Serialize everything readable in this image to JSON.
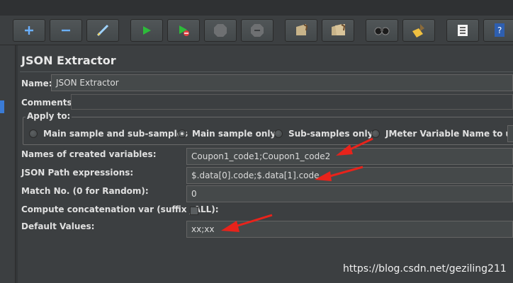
{
  "title": "JSON Extractor",
  "name": {
    "label": "Name:",
    "value": "JSON Extractor"
  },
  "comments": {
    "label": "Comments:",
    "value": ""
  },
  "apply_to": {
    "legend": "Apply to:",
    "options": [
      {
        "label": "Main sample and sub-samples",
        "selected": false
      },
      {
        "label": "Main sample only",
        "selected": true
      },
      {
        "label": "Sub-samples only",
        "selected": false
      },
      {
        "label": "JMeter Variable Name to use",
        "selected": false
      }
    ],
    "variable_value": ""
  },
  "fields": {
    "names": {
      "label": "Names of created variables:",
      "value": "Coupon1_code1;Coupon1_code2"
    },
    "json_path": {
      "label": "JSON Path expressions:",
      "value": "$.data[0].code;$.data[1].code"
    },
    "match_no": {
      "label": "Match No. (0 for Random):",
      "value": "0"
    },
    "concat": {
      "label": "Compute concatenation var (suffix _ALL):",
      "checked": false
    },
    "defaults": {
      "label": "Default Values:",
      "value": "xx;xx"
    }
  },
  "toolbar": {
    "buttons": [
      "add-icon",
      "remove-icon",
      "toggle-icon",
      "start-icon",
      "start-no-pauses-icon",
      "stop-icon",
      "shutdown-icon",
      "clear-icon",
      "clear-all-icon",
      "search-icon",
      "reset-search-icon",
      "function-helper-icon",
      "help-icon"
    ]
  },
  "annotation_color": "#e8231b",
  "watermark": "https://blog.csdn.net/geziling211"
}
